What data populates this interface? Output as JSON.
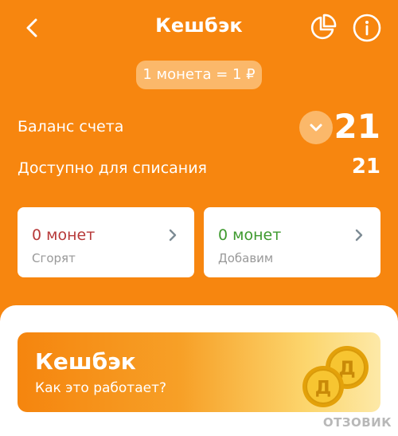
{
  "header": {
    "title": "Кешбэк",
    "back_icon": "chevron-left-icon",
    "stats_icon": "pie-chart-icon",
    "info_icon": "info-icon"
  },
  "rate": {
    "label": "1 монета = 1 ₽"
  },
  "balance": {
    "label": "Баланс счета",
    "value": "21",
    "toggle_icon": "chevron-down-icon"
  },
  "available": {
    "label": "Доступно для списания",
    "value": "21"
  },
  "cards": [
    {
      "amount": "0 монет",
      "caption": "Сгорят",
      "color": "#B73A3A"
    },
    {
      "amount": "0 монет",
      "caption": "Добавим",
      "color": "#3F9A2F"
    }
  ],
  "promo": {
    "title": "Кешбэк",
    "subtitle": "Как это работает?",
    "coin_letter": "Д"
  },
  "watermark": "ОТЗОВИК",
  "colors": {
    "background": "#F7860F",
    "pill": "#FBB86A",
    "card": "#FFFFFF"
  }
}
